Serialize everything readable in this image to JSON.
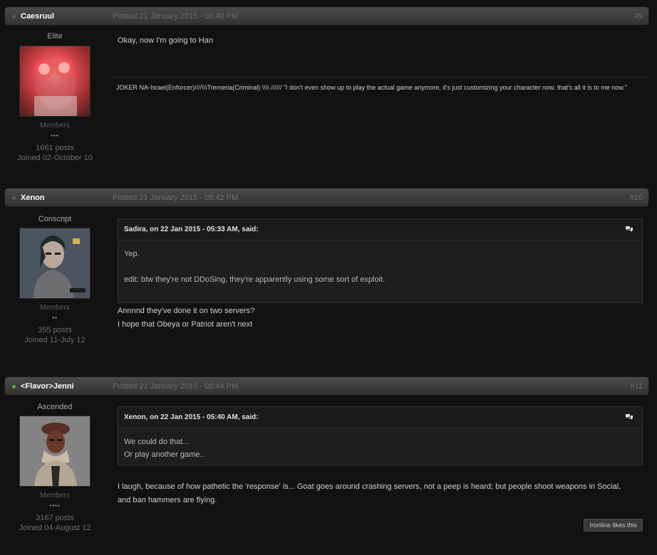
{
  "posts": [
    {
      "author": "Caesruul",
      "online": false,
      "posted": "Posted 21 January 2015 - 08:40 PM",
      "number": "#9",
      "rank": "Elite",
      "group": "Members",
      "pips": "▪▪▪",
      "posts": "1661 posts",
      "joined": "Joined 02-October 10",
      "body": [
        "Okay, now I'm going to Han"
      ],
      "signature": "JOKER NA-Israel(Enforcer)////\\\\\\Tremeria(Criminal) \\\\\\\\ ////// \"I don't even show up to play the actual game anymore, it's just customizing your character now. that's all it is to me now.\""
    },
    {
      "author": "Xenon",
      "online": false,
      "posted": "Posted 21 January 2015 - 08:42 PM",
      "number": "#10",
      "rank": "Conscript",
      "group": "Members",
      "pips": "▪▪",
      "posts": "355 posts",
      "joined": "Joined 11-July 12",
      "quote": {
        "cite": "Sadira, on 22 Jan 2015 - 05:33 AM, said:",
        "lines": [
          "Yep.",
          "",
          "",
          "edit: btw they're not DDoSing, they're apparently using some sort of exploit."
        ]
      },
      "body": [
        "Annnnd they've done it on two servers?",
        "I hope that Obeya or Patriot aren't next"
      ]
    },
    {
      "author": "<Flavor>Jenni",
      "online": true,
      "posted": "Posted 21 January 2015 - 08:44 PM",
      "number": "#11",
      "rank": "Ascended",
      "group": "Members",
      "pips": "▪▪▪▪",
      "posts": "3167 posts",
      "joined": "Joined 04-August 12",
      "quote": {
        "cite": "Xenon, on 22 Jan 2015 - 05:40 AM, said:",
        "lines": [
          "We could do that...",
          "Or play another game.."
        ]
      },
      "body": [
        "I laugh, because of how pathetic the 'response' is... Goat goes around crashing servers, not a peep is heard; but people shoot weapons in Social,",
        "and ban hammers are flying."
      ],
      "likes": "Ironline likes this"
    }
  ],
  "colors": {
    "online": "#4caf2a",
    "offline": "#5c5c5c",
    "bar": "#3c3c3c"
  },
  "icons": {
    "quote": "speech-bubbles-icon"
  }
}
